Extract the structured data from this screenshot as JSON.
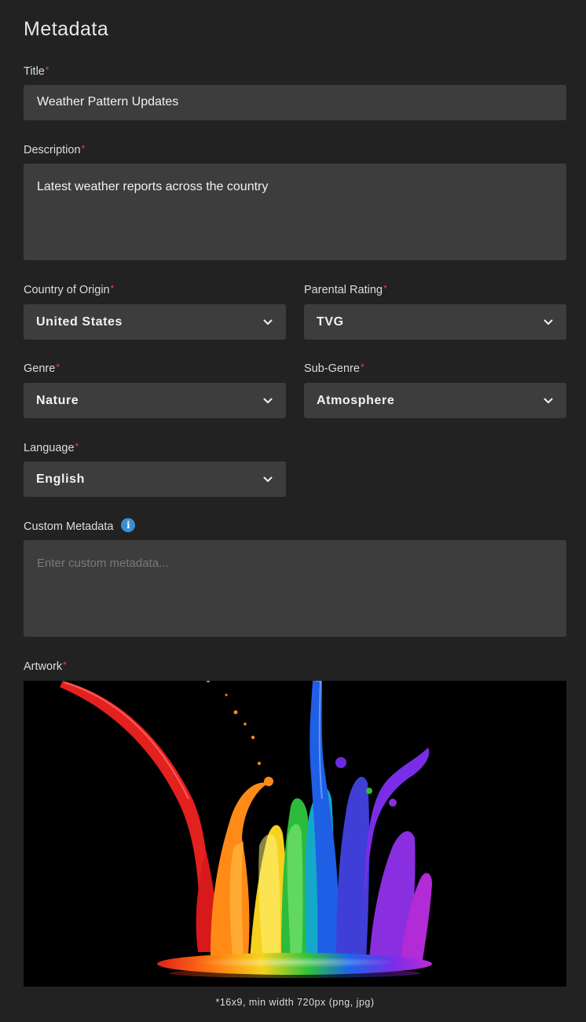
{
  "page": {
    "heading": "Metadata"
  },
  "fields": {
    "title": {
      "label": "Title",
      "required_mark": "*",
      "value": "Weather Pattern Updates"
    },
    "description": {
      "label": "Description",
      "required_mark": "*",
      "value": "Latest weather reports across the country"
    },
    "country": {
      "label": "Country of Origin",
      "required_mark": "*",
      "value": "United States"
    },
    "parental_rating": {
      "label": "Parental Rating",
      "required_mark": "*",
      "value": "TVG"
    },
    "genre": {
      "label": "Genre",
      "required_mark": "*",
      "value": "Nature"
    },
    "sub_genre": {
      "label": "Sub-Genre",
      "required_mark": "*",
      "value": "Atmosphere"
    },
    "language": {
      "label": "Language",
      "required_mark": "*",
      "value": "English"
    },
    "custom_metadata": {
      "label": "Custom Metadata",
      "value": "",
      "placeholder": "Enter custom metadata...",
      "info_icon": "info-icon"
    },
    "artwork": {
      "label": "Artwork",
      "required_mark": "*",
      "caption": "*16x9, min width 720px (png, jpg)"
    }
  },
  "icons": {
    "dropdown": "chevron-down-icon",
    "info": "info-icon"
  },
  "colors": {
    "background": "#222222",
    "field_background": "#3d3d3d",
    "required": "#e0483c",
    "info": "#3b8ed0"
  }
}
